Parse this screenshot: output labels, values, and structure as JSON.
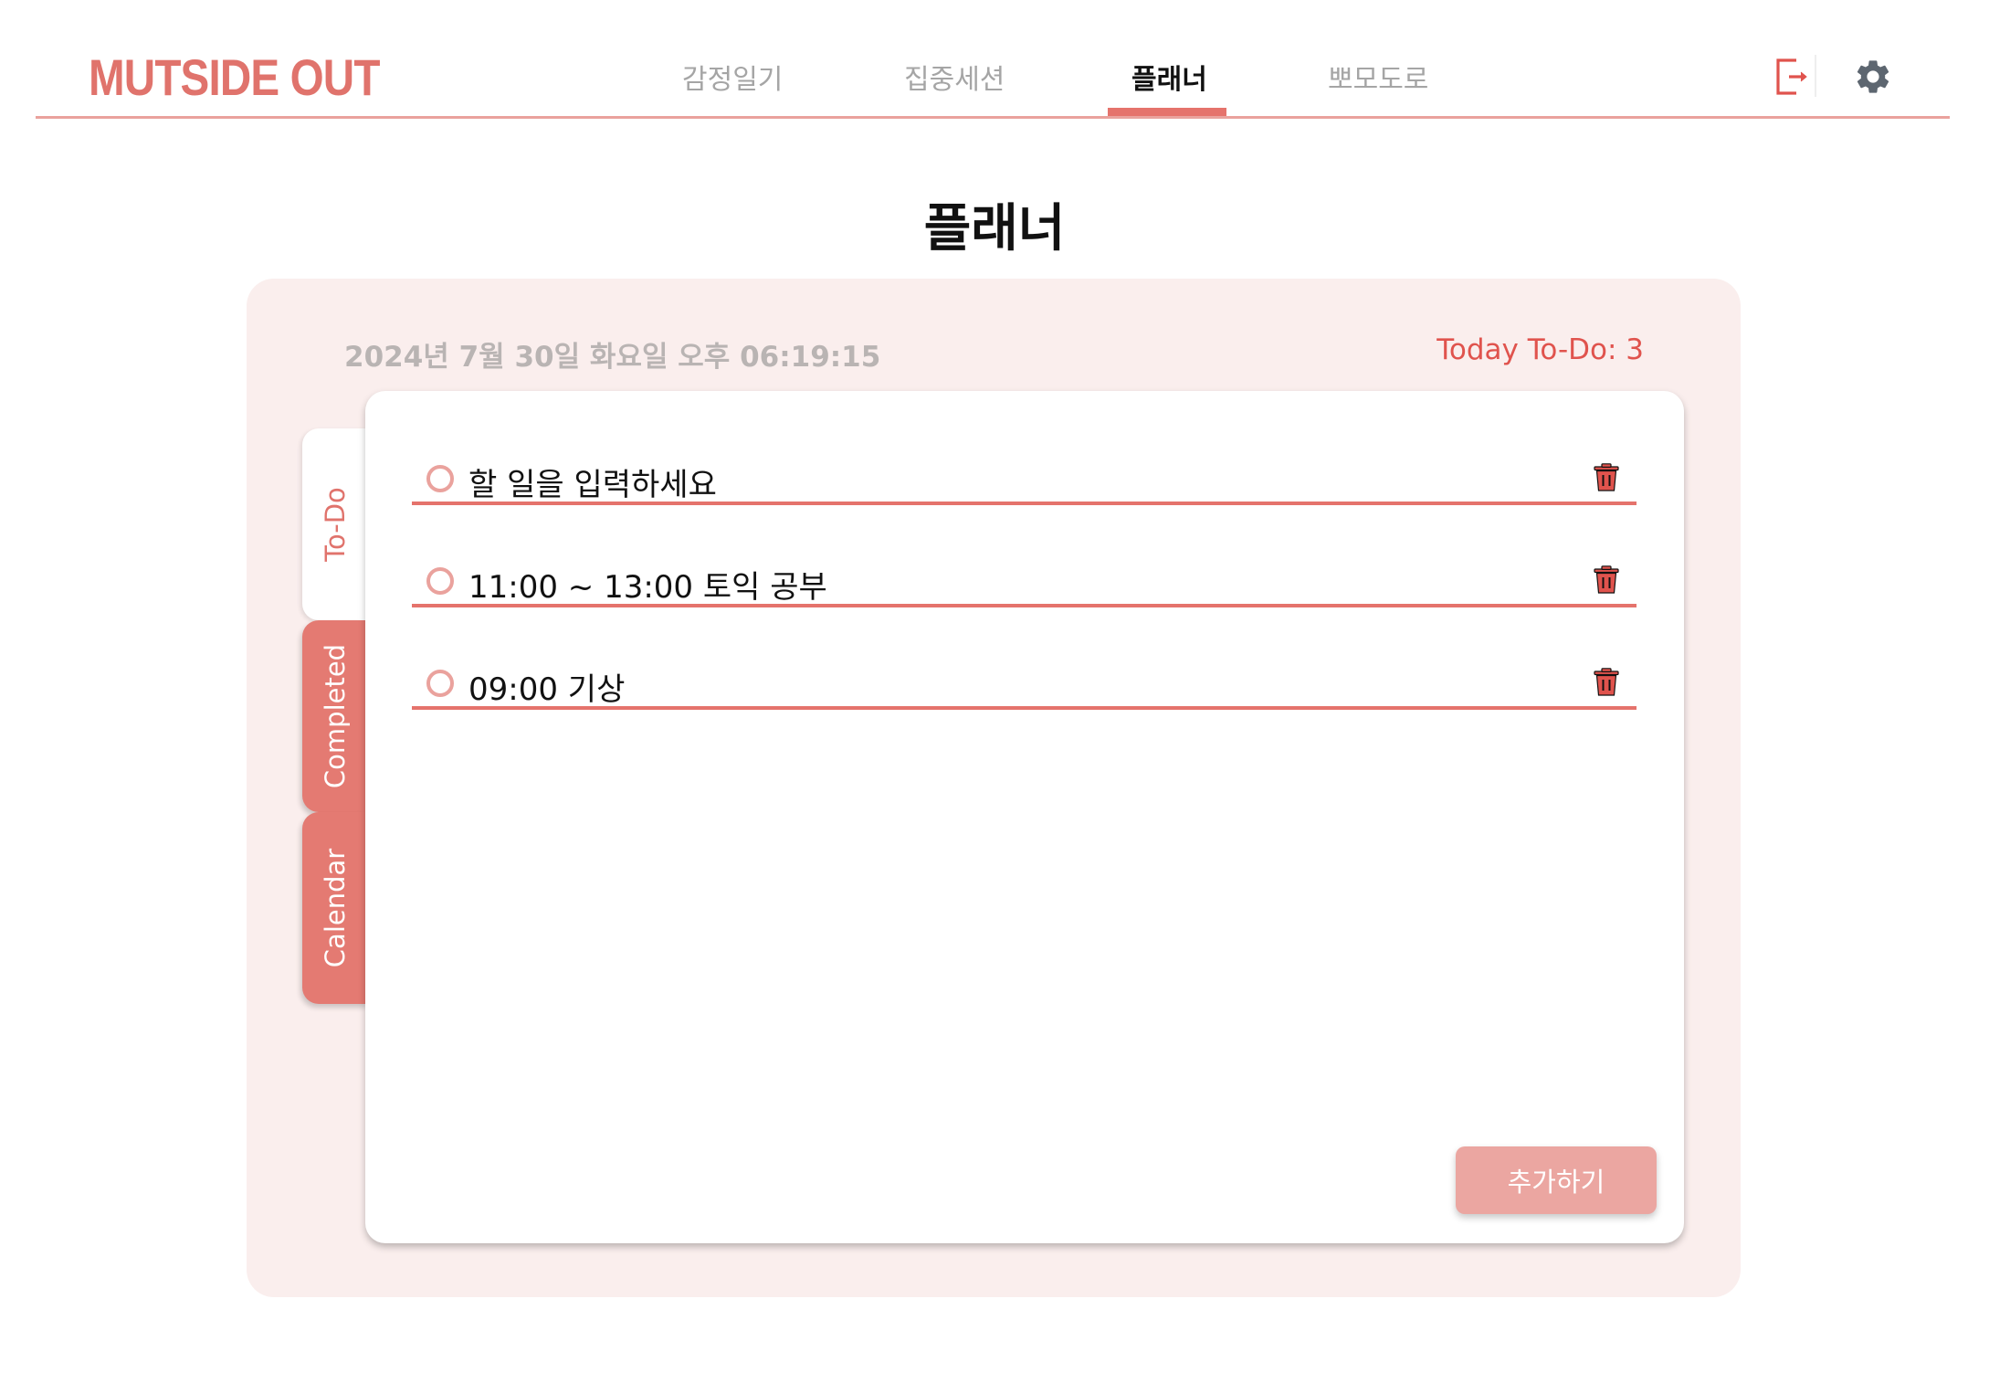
{
  "header": {
    "logo_text": "MUTSIDE OUT",
    "nav_tabs": [
      {
        "label": "감정일기",
        "active": false
      },
      {
        "label": "집중세션",
        "active": false
      },
      {
        "label": "플래너",
        "active": true
      },
      {
        "label": "뽀모도로",
        "active": false
      }
    ],
    "icons": {
      "logout": "logout-icon",
      "settings": "gear-icon"
    }
  },
  "page": {
    "title": "플래너"
  },
  "planner": {
    "datetime": "2024년 7월 30일 화요일 오후 06:19:15",
    "today_count": "Today To-Do: 3",
    "side_tabs": [
      {
        "label": "To-Do",
        "active": true
      },
      {
        "label": "Completed",
        "active": false
      },
      {
        "label": "Calendar",
        "active": false
      }
    ],
    "todos": [
      {
        "text": "할 일을 입력하세요",
        "completed": false
      },
      {
        "text": "11:00 ~ 13:00 토익 공부",
        "completed": false
      },
      {
        "text": "09:00 기상",
        "completed": false
      }
    ],
    "add_button_label": "추가하기"
  },
  "colors": {
    "accent": "#e5736c",
    "accent_light": "#eaa29d",
    "panel_bg": "#faeeed",
    "count_red": "#e0534d",
    "delete_red": "#e0534d",
    "gear_gray": "#5d6670"
  }
}
